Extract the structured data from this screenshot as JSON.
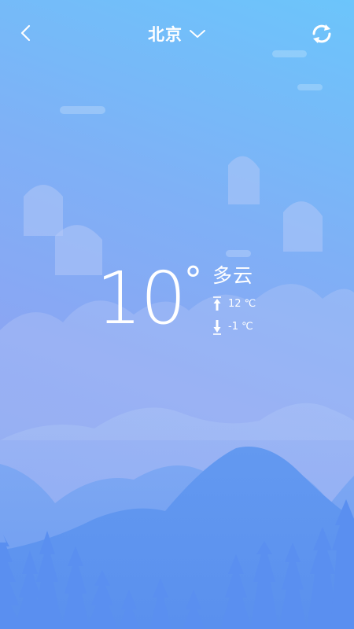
{
  "header": {
    "city": "北京",
    "back_icon": "chevron-left-icon",
    "dropdown_icon": "chevron-down-icon",
    "refresh_icon": "refresh-icon"
  },
  "weather": {
    "temperature": "10",
    "degree_symbol": "°",
    "condition": "多云",
    "high": "12 ℃",
    "low": "-1 ℃"
  },
  "colors": {
    "sky_top": "#6cc5fb",
    "sky_bottom": "#7d9cf0",
    "mountain_far": "#9db3f5",
    "mountain_mid": "#7aa2f1",
    "mountain_near": "#5b8fee",
    "text": "#ffffff"
  }
}
